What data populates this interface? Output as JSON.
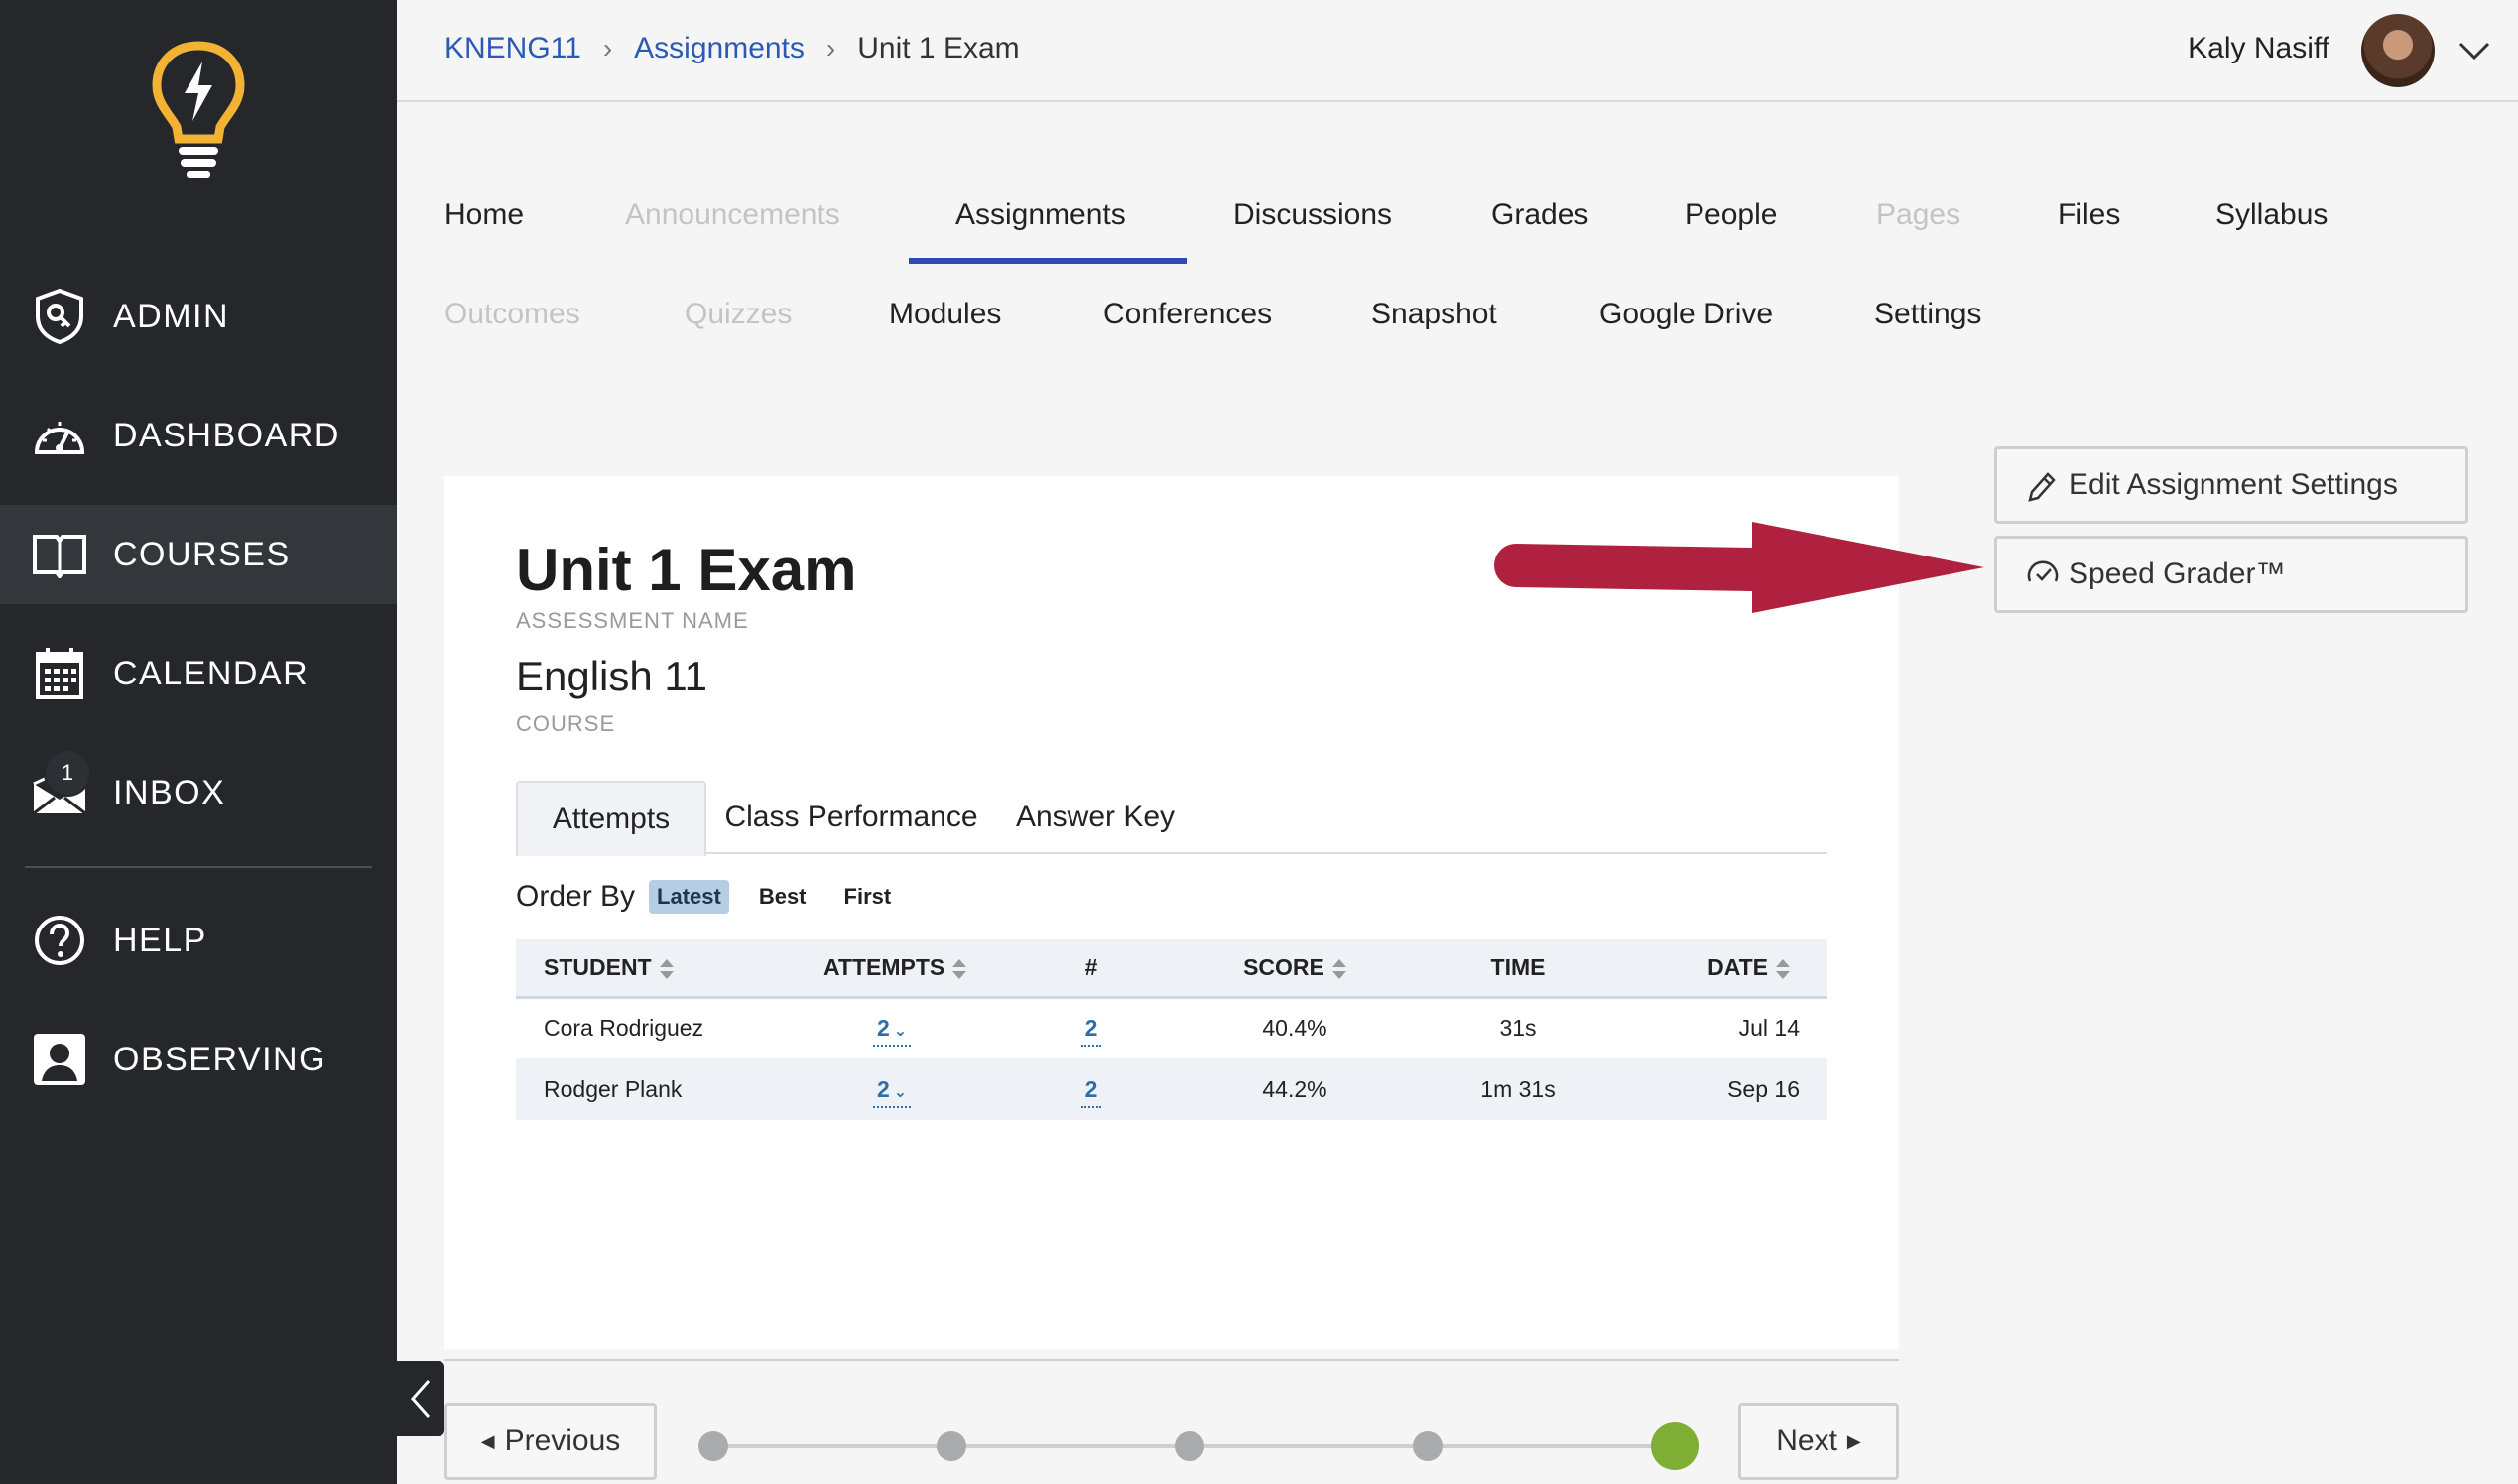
{
  "sidebar": {
    "items": [
      {
        "label": "ADMIN",
        "icon": "admin-shield-key-icon"
      },
      {
        "label": "DASHBOARD",
        "icon": "speedometer-icon"
      },
      {
        "label": "COURSES",
        "icon": "open-book-icon"
      },
      {
        "label": "CALENDAR",
        "icon": "calendar-icon"
      },
      {
        "label": "INBOX",
        "icon": "envelope-icon",
        "badge": "1"
      },
      {
        "label": "HELP",
        "icon": "question-circle-icon"
      },
      {
        "label": "OBSERVING",
        "icon": "person-icon"
      }
    ],
    "active": "COURSES",
    "logo_color": "#f2b233"
  },
  "header": {
    "breadcrumb": [
      "KNENG11",
      "Assignments",
      "Unit 1 Exam"
    ],
    "user_name": "Kaly Nasiff"
  },
  "course_nav": {
    "row1": [
      {
        "label": "Home",
        "enabled": true
      },
      {
        "label": "Announcements",
        "enabled": false
      },
      {
        "label": "Assignments",
        "enabled": true,
        "active": true
      },
      {
        "label": "Discussions",
        "enabled": true
      },
      {
        "label": "Grades",
        "enabled": true
      },
      {
        "label": "People",
        "enabled": true
      },
      {
        "label": "Pages",
        "enabled": false
      },
      {
        "label": "Files",
        "enabled": true
      },
      {
        "label": "Syllabus",
        "enabled": true
      }
    ],
    "row2": [
      {
        "label": "Outcomes",
        "enabled": false
      },
      {
        "label": "Quizzes",
        "enabled": false
      },
      {
        "label": "Modules",
        "enabled": true
      },
      {
        "label": "Conferences",
        "enabled": true
      },
      {
        "label": "Snapshot",
        "enabled": true
      },
      {
        "label": "Google Drive",
        "enabled": true
      },
      {
        "label": "Settings",
        "enabled": true
      }
    ],
    "accent": "#2a4bb8"
  },
  "assessment": {
    "title": "Unit 1 Exam",
    "title_label": "ASSESSMENT NAME",
    "course": "English 11",
    "course_label": "COURSE"
  },
  "tabs": [
    "Attempts",
    "Class Performance",
    "Answer Key"
  ],
  "order_by": {
    "label": "Order By",
    "options": [
      "Latest",
      "Best",
      "First"
    ],
    "selected": "Latest"
  },
  "table": {
    "headers": [
      "STUDENT",
      "ATTEMPTS",
      "#",
      "SCORE",
      "TIME",
      "DATE"
    ],
    "rows": [
      {
        "student": "Cora Rodriguez",
        "attempts": "2",
        "num": "2",
        "score": "40.4%",
        "time": "31s",
        "date": "Jul 14"
      },
      {
        "student": "Rodger Plank",
        "attempts": "2",
        "num": "2",
        "score": "44.2%",
        "time": "1m 31s",
        "date": "Sep 16"
      }
    ]
  },
  "actions": {
    "edit_settings": "Edit Assignment Settings",
    "speed_grader": "Speed Grader™"
  },
  "annotation_arrow_color": "#b0213f",
  "pager": {
    "previous": "Previous",
    "next": "Next",
    "steps": 5,
    "current_step": 5,
    "current_color": "#7fae35"
  }
}
